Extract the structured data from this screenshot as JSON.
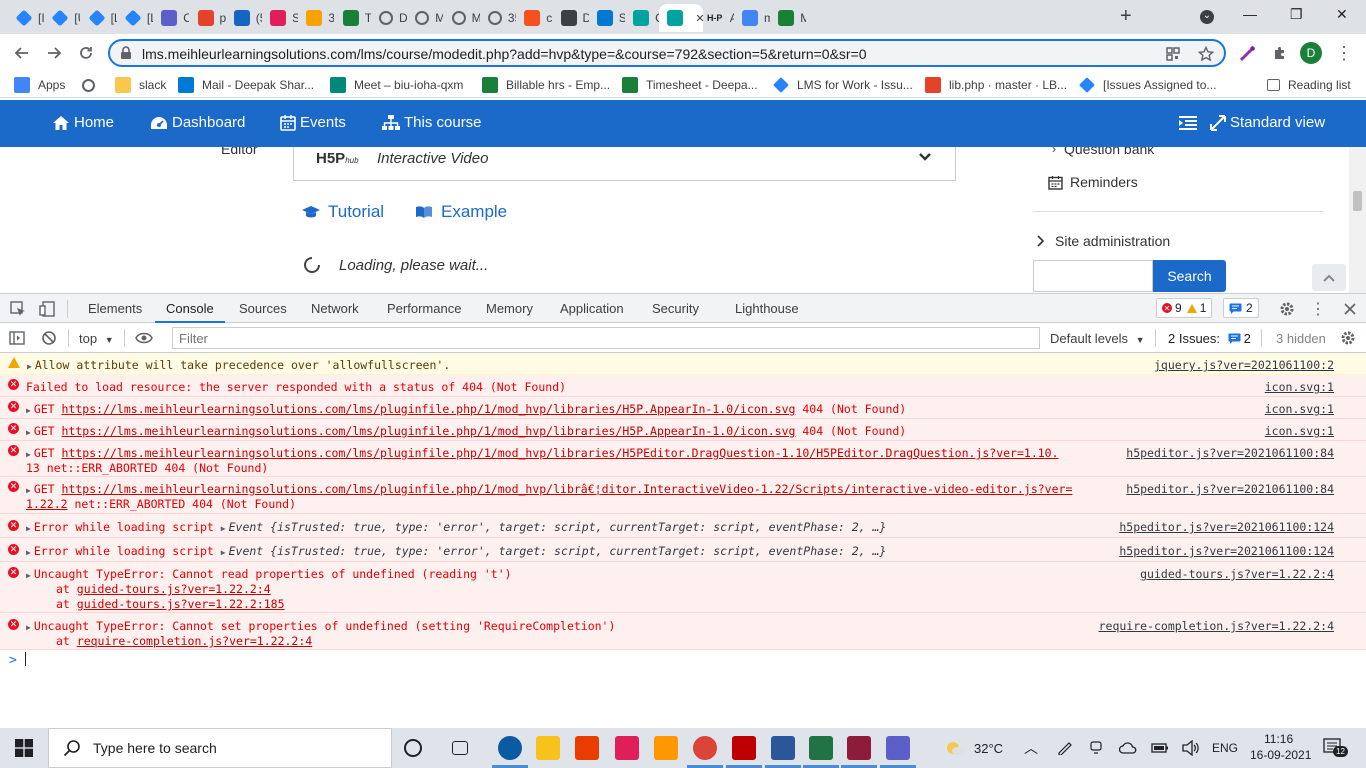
{
  "browser": {
    "tabs": [
      {
        "title": "[Is",
        "icon": "jira-diamond",
        "color": "#2684ff"
      },
      {
        "title": "[U",
        "icon": "jira-diamond",
        "color": "#2684ff"
      },
      {
        "title": "[L",
        "icon": "jira-diamond",
        "color": "#2684ff"
      },
      {
        "title": "[L",
        "icon": "jira-diamond",
        "color": "#2684ff"
      },
      {
        "title": "O",
        "icon": "teams-icon",
        "color": "#5b5fc7"
      },
      {
        "title": "pl",
        "icon": "gitlab-icon",
        "color": "#e24329"
      },
      {
        "title": "(5",
        "icon": "circle-icon",
        "color": "#1565c0"
      },
      {
        "title": "Sl",
        "icon": "slack-icon",
        "color": "#e01e5a"
      },
      {
        "title": "35",
        "icon": "pma-icon",
        "color": "#f4a300"
      },
      {
        "title": "Ti",
        "icon": "timesheet-icon",
        "color": "#188038"
      },
      {
        "title": "D",
        "icon": "globe-icon",
        "color": "#5f6368"
      },
      {
        "title": "M",
        "icon": "globe-icon",
        "color": "#5f6368"
      },
      {
        "title": "M",
        "icon": "globe-icon",
        "color": "#5f6368"
      },
      {
        "title": "35",
        "icon": "globe-icon",
        "color": "#5f6368"
      },
      {
        "title": "cF",
        "icon": "cp-icon",
        "color": "#f4511e"
      },
      {
        "title": "D",
        "icon": "drive-icon",
        "color": "#3c4043"
      },
      {
        "title": "Sk",
        "icon": "skype-icon",
        "color": "#0078d4"
      },
      {
        "title": "Cc",
        "icon": "moodle-a-icon",
        "color": "#00a3a0"
      },
      {
        "title": "",
        "icon": "moodle-a-icon",
        "color": "#00a3a0"
      },
      {
        "title": "Ac",
        "icon": "h5p-icon",
        "color": "#222222"
      },
      {
        "title": "m",
        "icon": "google-icon",
        "color": "#4285f4"
      },
      {
        "title": "M",
        "icon": "sheets-icon",
        "color": "#188038"
      }
    ],
    "url": "lms.meihleurlearningsolutions.com/lms/course/modedit.php?add=hvp&type=&course=792&section=5&return=0&sr=0",
    "profile_initial": "D",
    "bookmarks": [
      {
        "label": "Apps",
        "icon": "apps-grid-icon"
      },
      {
        "label": "",
        "icon": "globe-icon"
      },
      {
        "label": "slack",
        "icon": "folder-icon"
      },
      {
        "label": "Mail - Deepak Shar...",
        "icon": "outlook-icon"
      },
      {
        "label": "Meet – biu-ioha-qxm",
        "icon": "meet-icon"
      },
      {
        "label": "Billable hrs - Emp...",
        "icon": "sheets-plus-icon"
      },
      {
        "label": "Timesheet - Deepa...",
        "icon": "sheets-plus-icon"
      },
      {
        "label": "LMS for Work - Issu...",
        "icon": "jira-diamond"
      },
      {
        "label": "lib.php · master · LB...",
        "icon": "gitlab-icon"
      },
      {
        "label": "[Issues Assigned to...",
        "icon": "jira-diamond"
      },
      {
        "label": "Reading list",
        "icon": "reading-list-icon"
      }
    ]
  },
  "navbar": {
    "items": [
      "Home",
      "Dashboard",
      "Events",
      "This course"
    ],
    "standard_view": "Standard view",
    "color": "#1b6ac9"
  },
  "page": {
    "editor_label": "Editor",
    "content_type": "Interactive Video",
    "h5p_logo": "H5P",
    "h5p_logo_sub": "hub",
    "tutorial": "Tutorial",
    "example": "Example",
    "loading": "Loading, please wait...",
    "sidebar": {
      "question_bank": "Question bank",
      "reminders": "Reminders",
      "site_admin": "Site administration",
      "search_button": "Search"
    }
  },
  "devtools": {
    "tabs": [
      "Elements",
      "Console",
      "Sources",
      "Network",
      "Performance",
      "Memory",
      "Application",
      "Security",
      "Lighthouse"
    ],
    "active_tab": "Console",
    "error_count": "9",
    "warning_count": "1",
    "issue_count": "2",
    "context": "top",
    "filter_placeholder": "Filter",
    "levels": "Default levels",
    "issues_label": "2 Issues:",
    "issues_badge": "2",
    "hidden": "3 hidden"
  },
  "console": {
    "messages": [
      {
        "level": "warning",
        "text": "Allow attribute will take precedence over 'allowfullscreen'.",
        "source": "jquery.js?ver=2021061100:2"
      },
      {
        "level": "error",
        "text": "Failed to load resource: the server responded with a status of 404 (Not Found)",
        "source": "icon.svg:1"
      },
      {
        "level": "error",
        "prefix": "GET ",
        "link": "https://lms.meihleurlearningsolutions.com/lms/pluginfile.php/1/mod_hvp/libraries/H5P.AppearIn-1.0/icon.svg",
        "suffix": " 404 (Not Found)",
        "source": "icon.svg:1"
      },
      {
        "level": "error",
        "prefix": "GET ",
        "link": "https://lms.meihleurlearningsolutions.com/lms/pluginfile.php/1/mod_hvp/libraries/H5P.AppearIn-1.0/icon.svg",
        "suffix": " 404 (Not Found)",
        "source": "icon.svg:1"
      },
      {
        "level": "error",
        "prefix": "GET ",
        "link": "https://lms.meihleurlearningsolutions.com/lms/pluginfile.php/1/mod_hvp/libraries/H5PEditor.DragQuestion-1.10/H5PEditor.DragQuestion.js?ver=1.10.",
        "line2": "13 net::ERR_ABORTED 404 (Not Found)",
        "source": "h5peditor.js?ver=2021061100:84"
      },
      {
        "level": "error",
        "prefix": "GET ",
        "link": "https://lms.meihleurlearningsolutions.com/lms/pluginfile.php/1/mod_hvp/librâ€¦ditor.InteractiveVideo-1.22/Scripts/interactive-video-editor.js?ver=",
        "line2_link": "1.22.2",
        "line2": " net::ERR_ABORTED 404 (Not Found)",
        "source": "h5peditor.js?ver=2021061100:84"
      },
      {
        "level": "error",
        "text": "Error while loading script",
        "event": "Event {isTrusted: true, type: 'error', target: script, currentTarget: script, eventPhase: 2, …}",
        "source": "h5peditor.js?ver=2021061100:124"
      },
      {
        "level": "error",
        "text": "Error while loading script",
        "event": "Event {isTrusted: true, type: 'error', target: script, currentTarget: script, eventPhase: 2, …}",
        "source": "h5peditor.js?ver=2021061100:124"
      },
      {
        "level": "error",
        "text": "Uncaught TypeError: Cannot read properties of undefined (reading 't')",
        "trace": [
          "guided-tours.js?ver=1.22.2:4",
          "guided-tours.js?ver=1.22.2:185"
        ],
        "source": "guided-tours.js?ver=1.22.2:4"
      },
      {
        "level": "error",
        "text": "Uncaught TypeError: Cannot set properties of undefined (setting 'RequireCompletion')",
        "trace": [
          "require-completion.js?ver=1.22.2:4"
        ],
        "source": "require-completion.js?ver=1.22.2:4"
      }
    ],
    "trace_prefix": "at ",
    "prompt": ">"
  },
  "taskbar": {
    "search_placeholder": "Type here to search",
    "weather": "32°C",
    "language": "ENG",
    "time": "11:16",
    "date": "16-09-2021",
    "notification_count": "12"
  }
}
